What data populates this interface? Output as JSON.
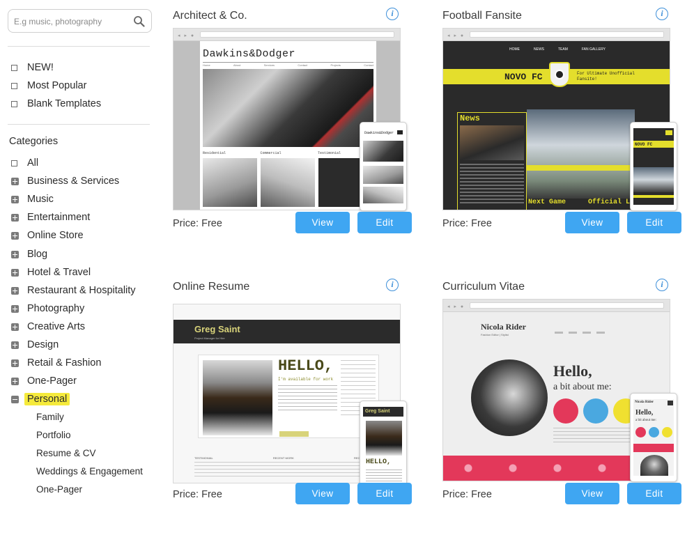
{
  "search": {
    "placeholder": "E.g music, photography",
    "icon": "search-icon"
  },
  "quick_filters": [
    "NEW!",
    "Most Popular",
    "Blank Templates"
  ],
  "categories": {
    "title": "Categories",
    "items": [
      "All",
      "Business & Services",
      "Music",
      "Entertainment",
      "Online Store",
      "Blog",
      "Hotel & Travel",
      "Restaurant & Hospitality",
      "Photography",
      "Creative Arts",
      "Design",
      "Retail & Fashion",
      "One-Pager",
      "Personal"
    ],
    "selected": "Personal",
    "sub_items": [
      "Family",
      "Portfolio",
      "Resume & CV",
      "Weddings & Engagement",
      "One-Pager"
    ]
  },
  "templates": [
    {
      "title": "Architect & Co.",
      "price": "Price: Free",
      "view_label": "View",
      "edit_label": "Edit",
      "preview": {
        "logo": "Dawkins&Dodger",
        "nav": [
          "Home",
          "About",
          "Services",
          "Contact",
          "Projects",
          "Contact"
        ],
        "sections": [
          "Residential",
          "Commercial",
          "Testimonial"
        ],
        "mobile_logo": "Dawkins&Dodger"
      }
    },
    {
      "title": "Football Fansite",
      "price": "Price: Free",
      "view_label": "View",
      "edit_label": "Edit",
      "preview": {
        "nav": [
          "HOME",
          "NEWS",
          "TEAM",
          "FAN GALLERY"
        ],
        "club": "NOVO FC",
        "tagline": "For Ultimate Unofficial Fansite!",
        "news": "News",
        "next_game": "Next Game",
        "official_links": "Official Links",
        "mobile_club": "NOVO FC"
      }
    },
    {
      "title": "Online Resume",
      "price": "Price: Free",
      "view_label": "View",
      "edit_label": "Edit",
      "preview": {
        "name": "Greg Saint",
        "role": "Project Manager for Hire",
        "hello": "HELLO,",
        "available": "I'm available for work",
        "sections": [
          "TESTIMONIAL",
          "RECENT WORK",
          "RECENT POSTS"
        ],
        "mobile_name": "Greg Saint",
        "mobile_hello": "HELLO,"
      }
    },
    {
      "title": "Curriculum Vitae",
      "price": "Price: Free",
      "view_label": "View",
      "edit_label": "Edit",
      "preview": {
        "name": "Nicola Rider",
        "role": "Fashion Editor | Stylist",
        "hello": "Hello,",
        "about": "a bit about me:",
        "mobile_name": "Nicola Rider",
        "mobile_hello": "Hello,",
        "mobile_about": "a bit about me:"
      }
    }
  ],
  "colors": {
    "button": "#3fa6f2",
    "info": "#3d8fd9",
    "highlight": "#f5ea3c"
  }
}
